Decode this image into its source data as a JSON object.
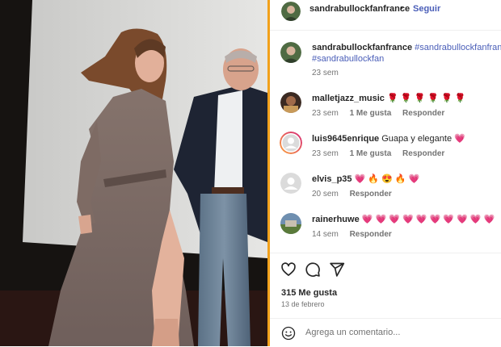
{
  "post": {
    "author": "sandrabullockfanfrance",
    "follow_label": "Seguir",
    "separator": "•",
    "caption_tags": "#sandrabullockfanfrance",
    "caption_tags2": "#sandrabullockfan",
    "caption_time": "23 sem",
    "likes": "315 Me gusta",
    "date": "13 de febrero",
    "add_comment_placeholder": "Agrega un comentario..."
  },
  "comments": [
    {
      "user": "malletjazz_music",
      "text": "🌹 🌹 🌹 🌹 🌹 🌹",
      "time": "23 sem",
      "likes": "1 Me gusta",
      "reply": "Responder"
    },
    {
      "user": "luis9645enrique",
      "text": "Guapa y elegante 💗",
      "time": "23 sem",
      "likes": "1 Me gusta",
      "reply": "Responder"
    },
    {
      "user": "elvis_p35",
      "text": "💗 🔥 😍 🔥 💗",
      "time": "20 sem",
      "reply": "Responder"
    },
    {
      "user": "rainerhuwe",
      "text": "💗 💗 💗 💗 💗 💗 💗 💗 💗 💗",
      "time": "14 sem",
      "reply": "Responder"
    }
  ],
  "colors": {
    "accent": "#f2a11b",
    "link": "#4a5eb8",
    "heart": "#ed3b6a"
  }
}
